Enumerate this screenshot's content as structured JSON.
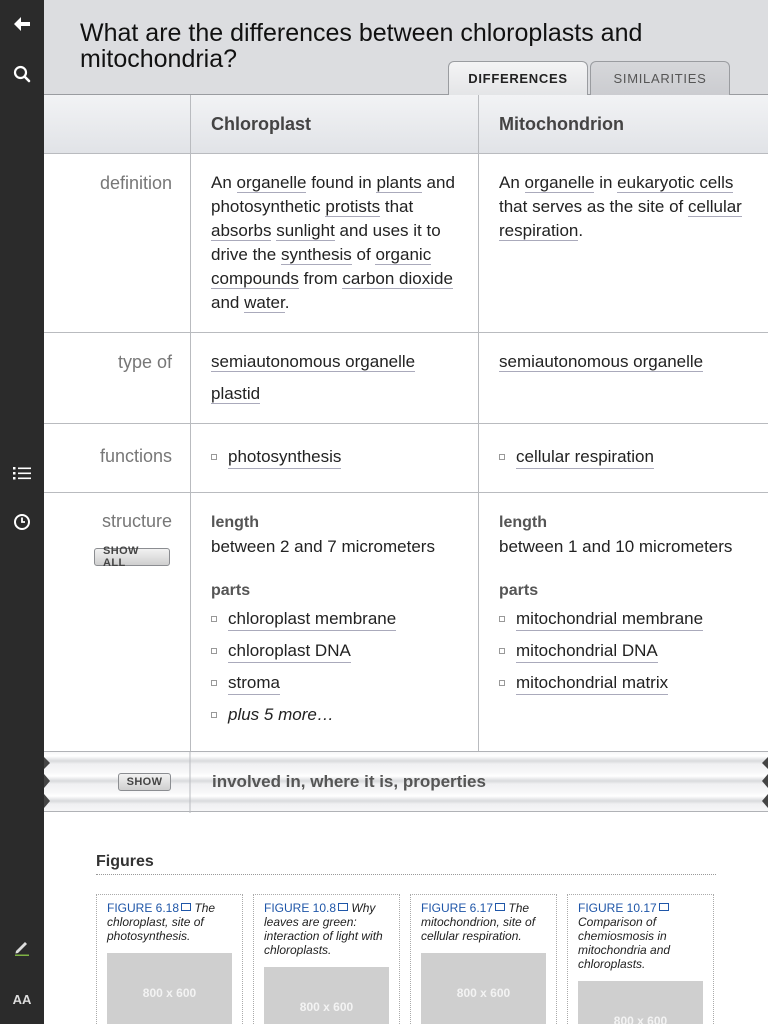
{
  "page": {
    "title": "What are the differences between chloroplasts and mitochondria?",
    "tabs": [
      {
        "label": "DIFFERENCES",
        "active": true
      },
      {
        "label": "SIMILARITIES",
        "active": false
      }
    ]
  },
  "sidebar": {
    "icons": [
      "back-arrow-icon",
      "search-icon",
      "list-icon",
      "history-clock-icon",
      "pencil-icon",
      "text-size-icon"
    ],
    "text_size_label": "AA"
  },
  "table": {
    "columns": [
      "Chloroplast",
      "Mitochondrion"
    ],
    "rows": {
      "definition": {
        "label": "definition",
        "chloroplast": "An organelle found in plants and photosynthetic protists that absorbs sunlight and uses it to drive the synthesis of organic compounds from carbon dioxide and water.",
        "mitochondrion": "An organelle in eukaryotic cells that serves as the site of cellular respiration."
      },
      "type_of": {
        "label": "type of",
        "chloroplast": [
          "semiautonomous organelle",
          "plastid"
        ],
        "mitochondrion": [
          "semiautonomous organelle"
        ]
      },
      "functions": {
        "label": "functions",
        "chloroplast": [
          "photosynthesis"
        ],
        "mitochondrion": [
          "cellular respiration"
        ]
      },
      "structure": {
        "label": "structure",
        "show_all_label": "SHOW ALL",
        "length_label": "length",
        "parts_label": "parts",
        "chloroplast": {
          "length": "between 2 and 7 micrometers",
          "parts": [
            "chloroplast membrane",
            "chloroplast DNA",
            "stroma"
          ],
          "more": "plus 5 more…"
        },
        "mitochondrion": {
          "length": "between 1 and 10 micrometers",
          "parts": [
            "mitochondrial membrane",
            "mitochondrial DNA",
            "mitochondrial matrix"
          ]
        }
      }
    },
    "hidden_rows": {
      "show_label": "SHOW",
      "summary": "involved in, where it is, properties"
    }
  },
  "figures": {
    "title": "Figures",
    "placeholder": "800 x 600",
    "items": [
      {
        "number": "FIGURE 6.18",
        "caption": "The chloroplast, site of photosynthesis."
      },
      {
        "number": "FIGURE 10.8",
        "caption": "Why leaves are green: interaction of light with chloroplasts."
      },
      {
        "number": "FIGURE 6.17",
        "caption": "The mitochondrion, site of cellular respiration."
      },
      {
        "number": "FIGURE 10.17",
        "caption": "Comparison of chemiosmosis in mitochondria and chloroplasts."
      }
    ]
  },
  "colors": {
    "sidebar": "#2b2b2b",
    "header": "#dcdde0",
    "link_blue": "#1f56a8"
  }
}
